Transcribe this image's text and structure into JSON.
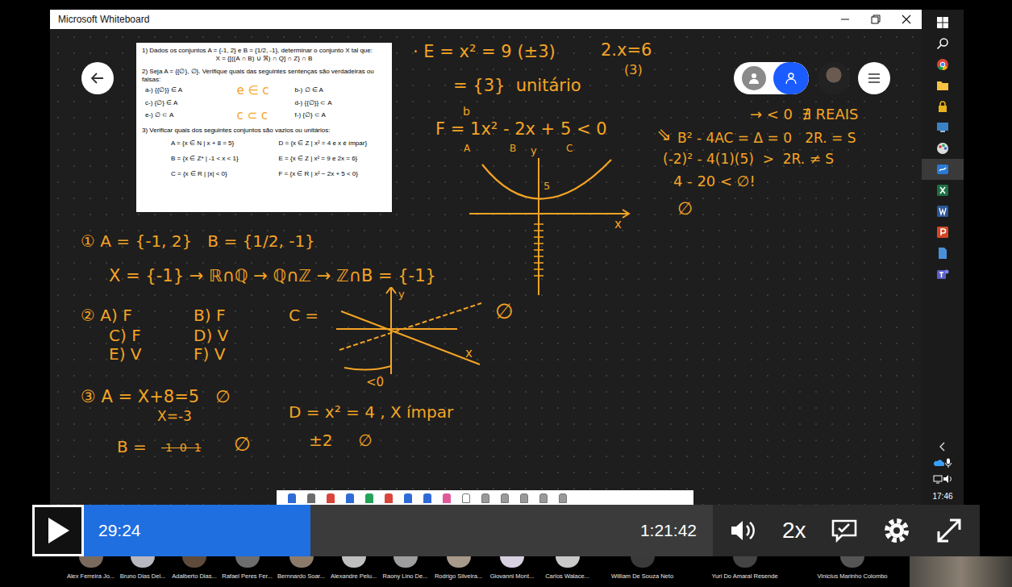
{
  "window": {
    "title": "Microsoft Whiteboard"
  },
  "document": {
    "q1": [
      "1) Dados os conjuntos A = {-1, 2} e B = {1/2, -1}, determinar o conjunto X tal que:",
      "X = {[((A ∩ B) ∪ ℜ) ∩ Q] ∩ Z} ∩ B"
    ],
    "q2": "2) Seja A = {{∅}, ∅}. Verifique quais das seguintes sentenças são verdadeiras ou falsas:",
    "q2_items": [
      "a-) {{∅}} ∈ A",
      "b-) ∅ ∈ A",
      "c-) {∅} ∈ A",
      "d-) {{∅}} ⊂ A",
      "e-) ∅ ⊂ A",
      "f-) {∅} ⊂ A"
    ],
    "annotations": [
      "e ∈ c",
      "c ⊂ c"
    ],
    "q3": "3) Verificar quais dos seguintes conjuntos são vazios ou unitários:",
    "q3_items": [
      "A = {x ∈ N | x + 8 = 5}",
      "D = {x ∈ Z | x² = 4 e x é ímpar}",
      "B = {x ∈ Z* | -1 < x < 1}",
      "E = {x ∈ Z | x² = 9 e 2x = 6}",
      "C = {x ∈ R | |x| < 0}",
      "F = {x ∈ R | x² − 2x + 5 < 0}"
    ]
  },
  "notes": [
    {
      "text": "· E = x² = 9 (±3)",
      "struck": false
    },
    {
      "text": "2.x=6",
      "struck": false
    },
    {
      "text": "(3)",
      "struck": false
    },
    {
      "text": "= {3}  unitário",
      "struck": false
    },
    {
      "text": "b",
      "struck": false
    },
    {
      "text": "F = 1x² - 2x + 5 < 0",
      "struck": false
    },
    {
      "text": "A",
      "struck": false
    },
    {
      "text": "B",
      "struck": false
    },
    {
      "text": "C",
      "struck": false
    },
    {
      "text": "⇘",
      "struck": false
    },
    {
      "text": "→ < 0  ∄ REAIS",
      "struck": false
    },
    {
      "text": "B² - 4AC = Δ = 0   2R. = S",
      "struck": false
    },
    {
      "text": "(-2)² - 4(1)(5)  >  2R. ≠ S",
      "struck": false
    },
    {
      "text": "4 - 20 < ∅!",
      "struck": false
    },
    {
      "text": "∅",
      "struck": false
    },
    {
      "text": "5",
      "struck": false
    },
    {
      "text": "y",
      "struck": false
    },
    {
      "text": "x",
      "struck": false
    },
    {
      "text": "① A = {-1, 2}   B = {1/2, -1}",
      "struck": false
    },
    {
      "text": "X = {-1} → ℝ∩ℚ → ℚ∩ℤ → ℤ∩B = {-1}",
      "struck": false
    },
    {
      "text": "② A) F",
      "struck": false
    },
    {
      "text": "B) F",
      "struck": false
    },
    {
      "text": "C) F",
      "struck": false
    },
    {
      "text": "D) V",
      "struck": false
    },
    {
      "text": "E) V",
      "struck": false
    },
    {
      "text": "F) V",
      "struck": false
    },
    {
      "text": "C =",
      "struck": false
    },
    {
      "text": "y",
      "struck": false
    },
    {
      "text": "x",
      "struck": false
    },
    {
      "text": "<0",
      "struck": false
    },
    {
      "text": "∅",
      "struck": false
    },
    {
      "text": "③ A = X+8=5   ∅",
      "struck": false
    },
    {
      "text": "X=-3",
      "struck": false
    },
    {
      "text": "B =",
      "struck": false
    },
    {
      "text": "-1  0  1",
      "struck": true
    },
    {
      "text": "∅",
      "struck": false
    },
    {
      "text": "D = x² = 4 , X ímpar",
      "struck": false
    },
    {
      "text": "±2     ∅",
      "struck": false
    }
  ],
  "taskbar": {
    "time": "17:46",
    "items": [
      {
        "selected": false
      },
      {
        "selected": false
      },
      {
        "selected": false
      },
      {
        "selected": false
      },
      {
        "selected": false
      },
      {
        "selected": false
      },
      {
        "selected": false
      },
      {
        "selected": true
      },
      {
        "selected": false
      },
      {
        "selected": false
      },
      {
        "selected": false
      },
      {
        "selected": false
      },
      {
        "selected": false
      }
    ]
  },
  "player": {
    "current": "29:24",
    "duration": "1:21:42",
    "level": 0.36,
    "speed": "2x",
    "playing": false
  },
  "participants": [
    "Alex Ferreira Jo...",
    "Bruno Dias Del...",
    "Adalberto Dias...",
    "Rafael Peres Fer...",
    "Bernnardo Soar...",
    "Alexandre Pelu...",
    "Raony Lino De...",
    "Rodrigo Silveira...",
    "Giovanni Mont...",
    "Carlos Walace...",
    "William De Souza Neto",
    "Yuri Do Amaral Resende",
    "Vinicius Marinho Colombo"
  ]
}
